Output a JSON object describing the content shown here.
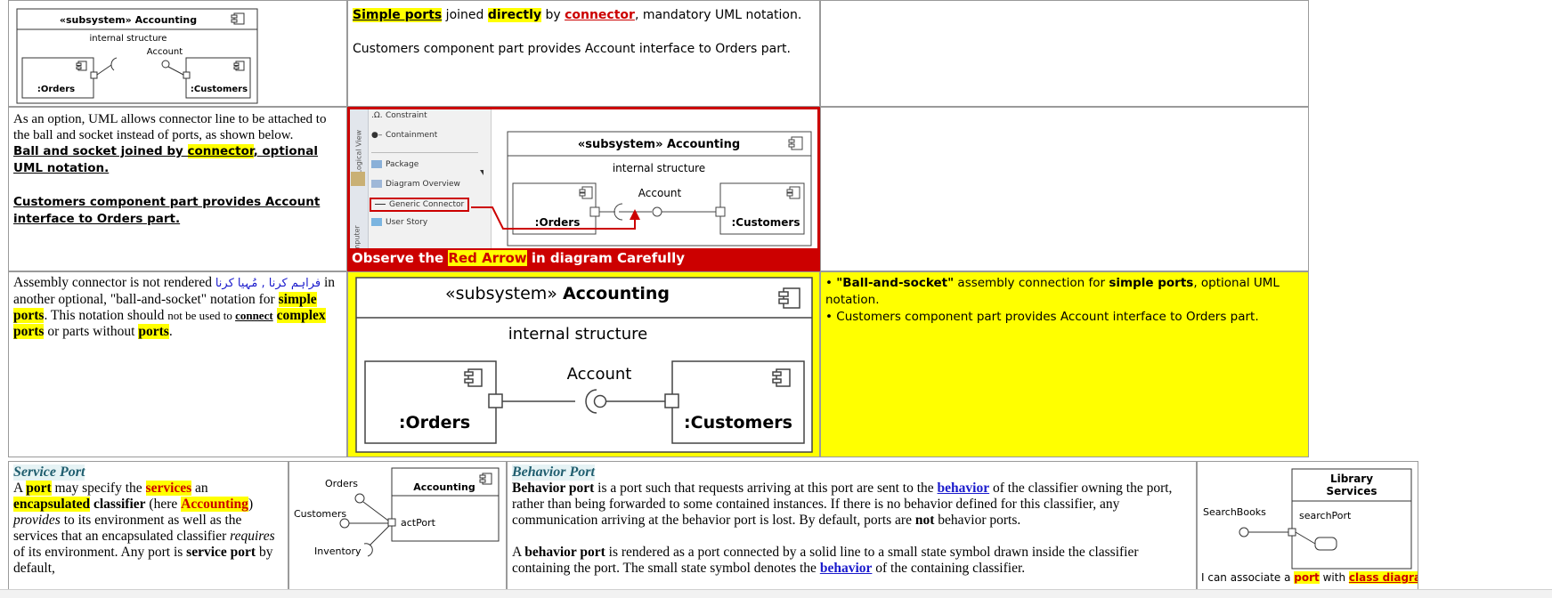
{
  "row1": {
    "diagram": {
      "stereotype": "«subsystem» Accounting",
      "subtitle": "internal structure",
      "iface": "Account",
      "left": ":Orders",
      "right": ":Customers"
    },
    "mid": {
      "l1_a": "Simple ports",
      "l1_b": " joined ",
      "l1_c": "directly",
      "l1_d": " by ",
      "l1_e": "connector",
      "l1_f": ", mandatory UML notation.",
      "l2": "Customers component part provides Account interface to Orders part."
    }
  },
  "row2": {
    "text": {
      "p1": "As an option, UML allows connector line to be attached to the ball and socket instead of ports, as shown below.",
      "p2_a": "Ball and socket joined by ",
      "p2_b": "connector",
      "p2_c": ", optional UML notation.",
      "p3": "Customers component part provides Account interface to Orders part."
    },
    "palette": {
      "items": [
        "Constraint",
        "Containment",
        "Package",
        "Diagram Overview",
        "Generic Connector",
        "User Story"
      ],
      "tab1": "Logical View",
      "tab2": "mputer"
    },
    "diagram": {
      "stereotype": "«subsystem» Accounting",
      "subtitle": "internal structure",
      "iface": "Account",
      "left": ":Orders",
      "right": ":Customers"
    },
    "banner": {
      "a": "Observe the ",
      "b": "Red Arrow",
      "c": " in diagram Carefully"
    }
  },
  "row3": {
    "text": {
      "a": "Assembly connector is not rendered ",
      "urdu": "فراہم کرنا , مُہیا کرنا",
      "b": " in another optional, \"ball-and-socket\" notation for ",
      "c": "simple ports",
      "d": ". This notation should ",
      "e": "not be used to ",
      "f": "connect",
      "g": " ",
      "h": "complex ports",
      "k": " or parts without ",
      "m": "ports",
      "n": "."
    },
    "diagram": {
      "stereotype_a": "«subsystem» ",
      "stereotype_b": "Accounting",
      "subtitle": "internal structure",
      "iface": "Account",
      "left": ":Orders",
      "right": ":Customers"
    },
    "bullets": {
      "b1_a": "\"Ball-and-socket\"",
      "b1_b": " assembly connection for ",
      "b1_c": "simple ports",
      "b1_d": ", optional UML notation.",
      "b2": "Customers component part provides Account interface to Orders part."
    }
  },
  "row4": {
    "service": {
      "title": "Service Port",
      "a": "A ",
      "b": "port",
      "c": " may specify the ",
      "d": "services",
      "e": " an ",
      "f": "encapsulated",
      "g": " classifier",
      "h": " (here ",
      "k": "Accounting",
      "m": ") ",
      "n": "provides",
      "o": " to its environment as well as the services that an encapsulated classifier ",
      "p": "requires",
      "q": " of its environment. Any port is ",
      "r": "service port",
      "s": " by default,"
    },
    "service_diagram": {
      "orders": "Orders",
      "customers": "Customers",
      "inventory": "Inventory",
      "box": "Accounting",
      "port": "actPort"
    },
    "behavior": {
      "title": "Behavior Port",
      "a": "Behavior port",
      "b": " is a port such that requests arriving at this port are sent to the ",
      "c": "behavior",
      "d": " of the classifier owning the port, rather than being forwarded to some contained instances. If there is no behavior defined for this classifier, any communication arriving at the behavior port is lost. By default, ports are ",
      "e": "not",
      "f": " behavior ports.",
      "g": "A ",
      "h": "behavior port",
      "k": " is rendered as a port connected by a solid line to a small state symbol drawn inside the classifier containing the port. The small state symbol denotes the ",
      "m": "behavior",
      "n": " of the containing classifier."
    },
    "library": {
      "title1": "Library",
      "title2": "Services",
      "search": "SearchBooks",
      "port": "searchPort",
      "caption_a": "I can associate a ",
      "caption_b": "port",
      "caption_c": " with ",
      "caption_d": "class diagram"
    }
  }
}
